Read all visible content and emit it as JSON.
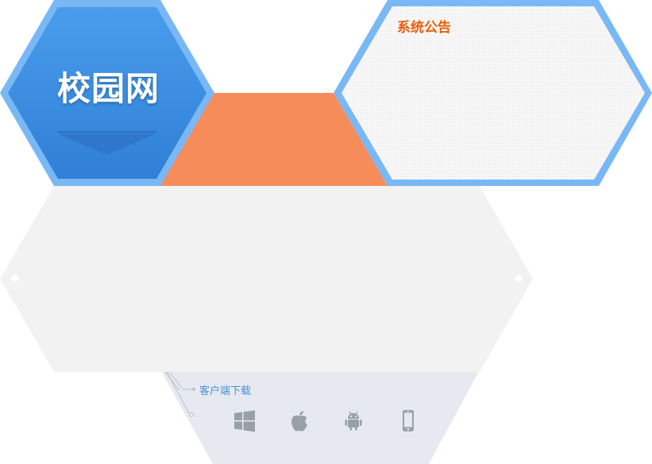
{
  "brand": {
    "title": "校园网"
  },
  "notice": {
    "title": "系统公告"
  },
  "download": {
    "label": "客户端下载",
    "platforms": [
      {
        "name": "windows",
        "icon": "windows-icon"
      },
      {
        "name": "apple",
        "icon": "apple-icon"
      },
      {
        "name": "android",
        "icon": "android-icon"
      },
      {
        "name": "mobile",
        "icon": "phone-icon"
      }
    ]
  },
  "colors": {
    "blue": "#3b8ee0",
    "blue_border": "#79b8f5",
    "orange": "#f58c5a",
    "gray_panel": "#f2f2f2",
    "light_panel": "#e6eaf0",
    "notice_title": "#e8600c"
  }
}
